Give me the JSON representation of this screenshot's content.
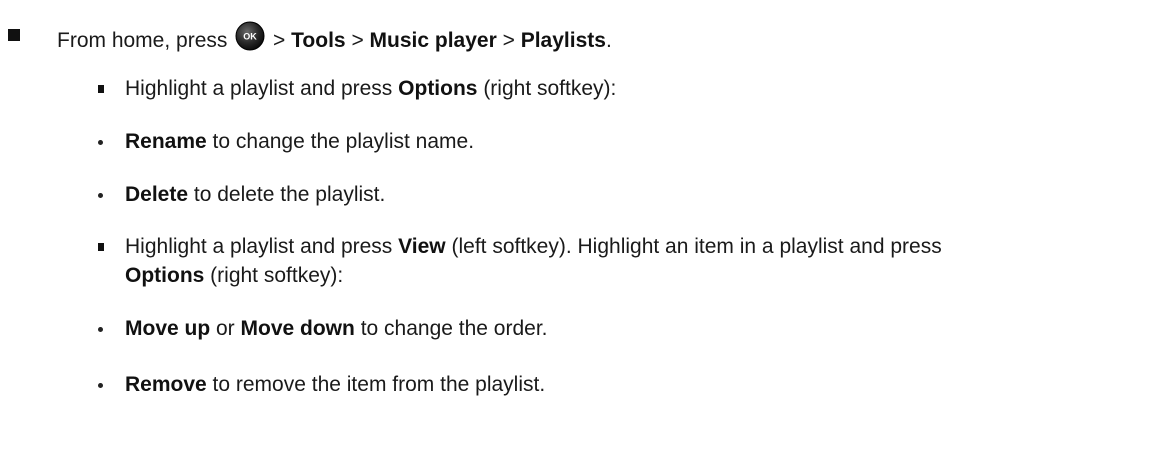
{
  "steps": [
    {
      "level": 1,
      "segments": [
        {
          "text": "From home, press ",
          "bold": false
        },
        {
          "icon": "ok-button-icon",
          "label": "OK"
        },
        {
          "text": " > ",
          "bold": false
        },
        {
          "text": "Tools",
          "bold": true
        },
        {
          "text": " > ",
          "bold": false
        },
        {
          "text": "Music player",
          "bold": true
        },
        {
          "text": " > ",
          "bold": false
        },
        {
          "text": "Playlists",
          "bold": true
        },
        {
          "text": ".",
          "bold": false
        }
      ]
    },
    {
      "level": 2,
      "segments": [
        {
          "text": "Highlight a playlist and press ",
          "bold": false
        },
        {
          "text": "Options",
          "bold": true
        },
        {
          "text": " (right softkey):",
          "bold": false
        }
      ]
    },
    {
      "level": 3,
      "segments": [
        {
          "text": "Rename",
          "bold": true
        },
        {
          "text": " to change the playlist name.",
          "bold": false
        }
      ]
    },
    {
      "level": 3,
      "segments": [
        {
          "text": "Delete",
          "bold": true
        },
        {
          "text": " to delete the playlist.",
          "bold": false
        }
      ]
    },
    {
      "level": 2,
      "segments": [
        {
          "text": "Highlight a playlist and press ",
          "bold": false
        },
        {
          "text": "View",
          "bold": true
        },
        {
          "text": " (left softkey). Highlight an item in a playlist and press",
          "bold": false
        }
      ]
    },
    {
      "level": 2,
      "continuation": true,
      "segments": [
        {
          "text": "Options",
          "bold": true
        },
        {
          "text": " (right softkey):",
          "bold": false
        }
      ]
    },
    {
      "level": 3,
      "segments": [
        {
          "text": "Move up",
          "bold": true
        },
        {
          "text": " or ",
          "bold": false
        },
        {
          "text": "Move down",
          "bold": true
        },
        {
          "text": " to change the order.",
          "bold": false
        }
      ]
    },
    {
      "level": 3,
      "segments": [
        {
          "text": "Remove",
          "bold": true
        },
        {
          "text": " to remove the item from the playlist.",
          "bold": false
        }
      ]
    }
  ],
  "icons": {
    "ok_button": {
      "name": "ok-button-icon",
      "label": "OK",
      "color": "#1c1c1c"
    }
  }
}
